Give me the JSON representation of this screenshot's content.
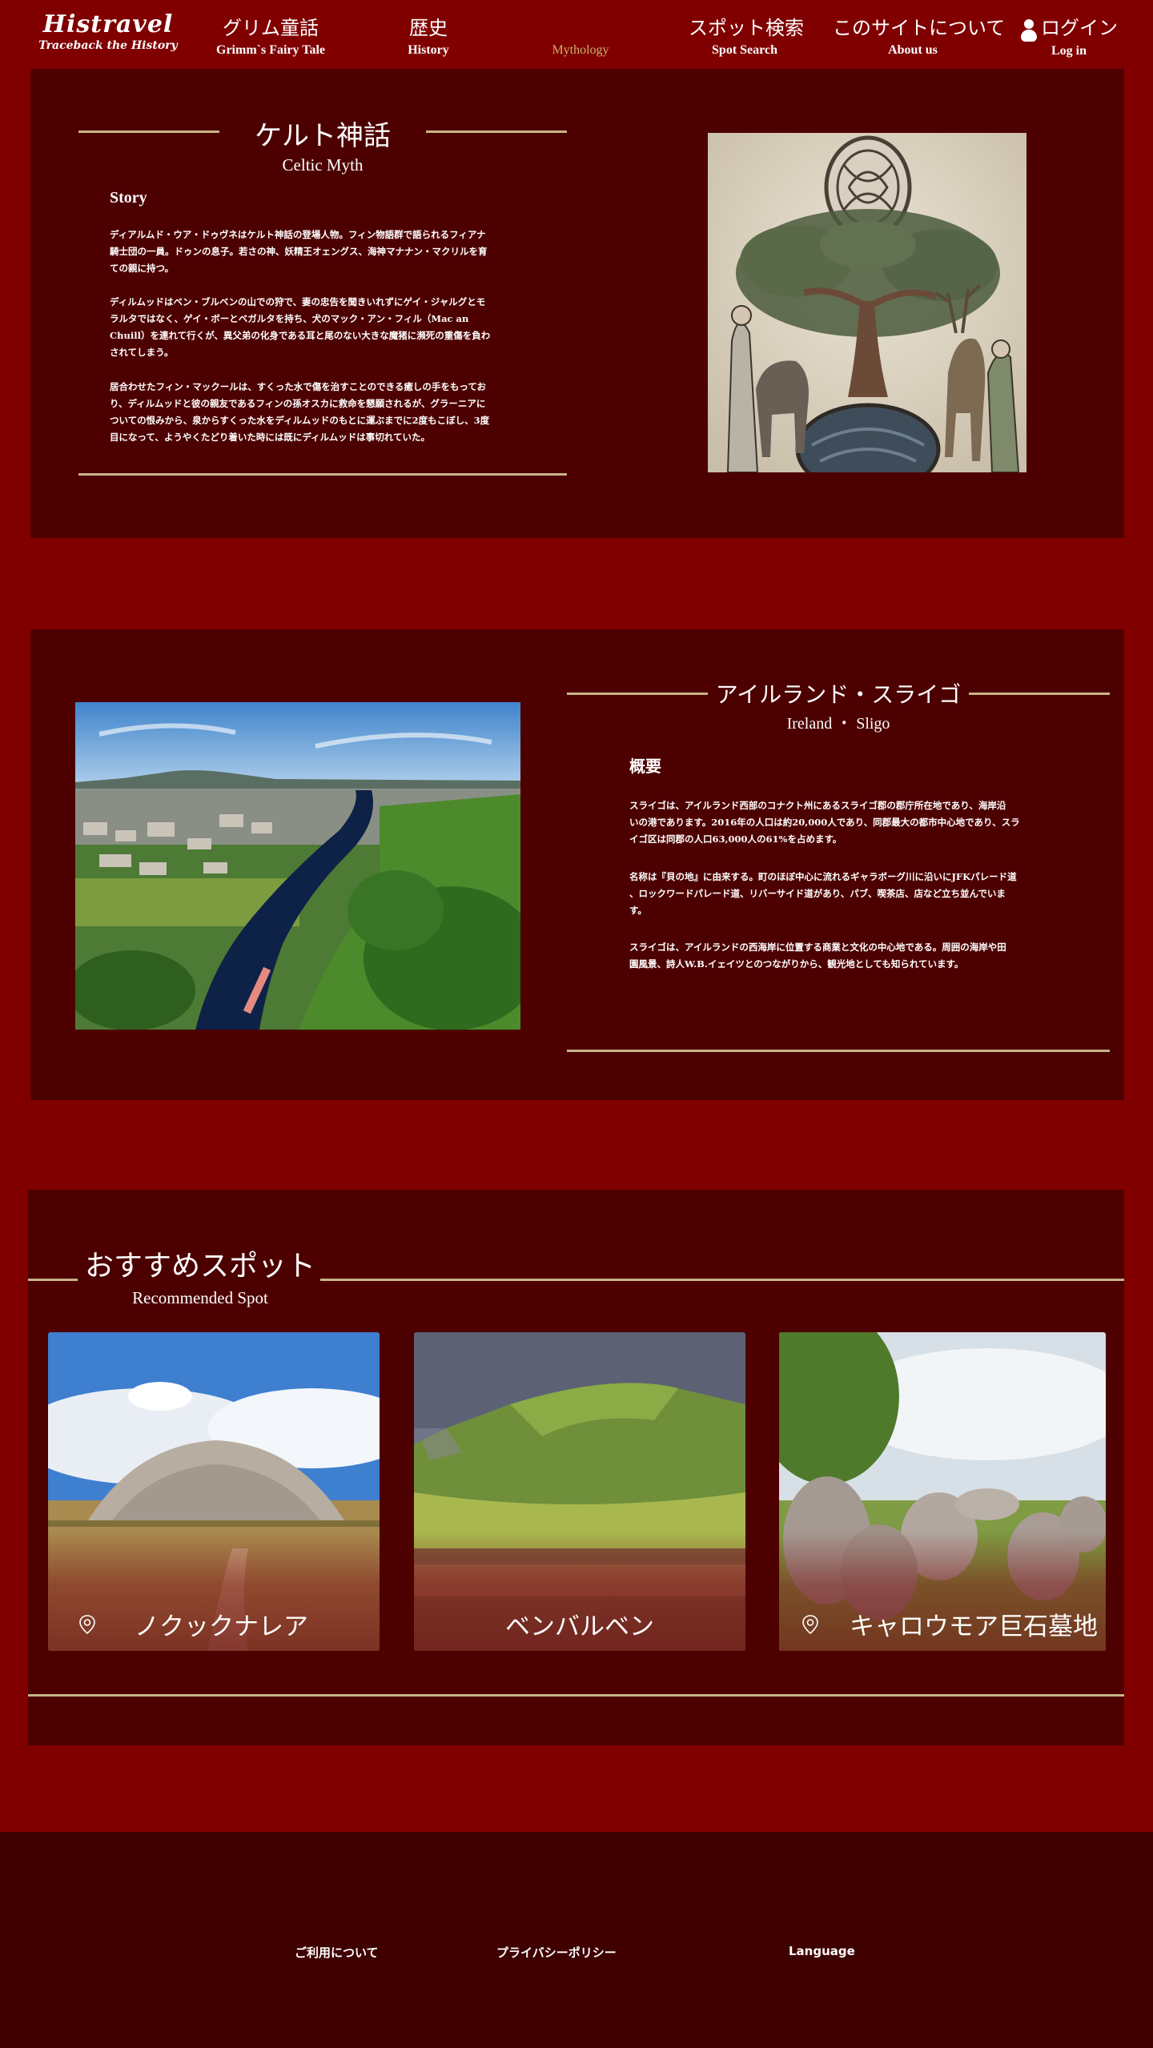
{
  "header": {
    "logo_title": "Histravel",
    "logo_subtitle": "Traceback the History",
    "nav": [
      {
        "jp": "グリム童話",
        "en": "Grimm`s Fairy Tale"
      },
      {
        "jp": "歴史",
        "en": "History"
      },
      {
        "jp": "",
        "en": "Mythology"
      },
      {
        "jp": "スポット検索",
        "en": "Spot Search"
      },
      {
        "jp": "このサイトについて",
        "en": "About us"
      },
      {
        "jp": "ログイン",
        "en": "Log in"
      }
    ],
    "active_nav": "Mythology"
  },
  "myth": {
    "title_jp": "ケルト神話",
    "title_en": "Celtic Myth",
    "section_label": "Story",
    "paragraphs": [
      [
        "ディアルムド・ウア・ドゥヴネはケルト神話の登場人物。フィン物語群で語られるフィアナ",
        "騎士団の一員。ドゥンの息子。若さの神、妖精王オェングス、海神マナナン・マクリルを育",
        "ての親に持つ。"
      ],
      [
        "ディルムッドはベン・ブルベンの山での狩で、妻の忠告を聞きいれずにゲイ・ジャルグとモ",
        "ラルタではなく、ゲイ・ボーとベガルタを持ち、犬のマック・アン・フィル（Mac an",
        "Chuill）を連れて行くが、異父弟の化身である耳と尾のない大きな魔猪に瀕死の重傷を負わ",
        "されてしまう。"
      ],
      [
        "居合わせたフィン・マックールは、すくった水で傷を治すことのできる癒しの手をもってお",
        "り、ディルムッドと彼の親友であるフィンの孫オスカに救命を懇願されるが、グラーニアに",
        "ついての恨みから、泉からすくった水をディルムッドのもとに運ぶまでに2度もこぼし、3度",
        "目になって、ようやくたどり着いた時には既にディルムッドは事切れていた。"
      ]
    ]
  },
  "place": {
    "title_jp": "アイルランド・スライゴ",
    "title_en": "Ireland ・ Sligo",
    "section_label": "概要",
    "paragraphs": [
      [
        "スライゴは、アイルランド西部のコナクト州にあるスライゴ郡の郡庁所在地であり、海岸沿",
        "いの港であります。2016年の人口は約20,000人であり、同郡最大の都市中心地であり、スラ",
        "イゴ区は同郡の人口63,000人の61%を占めます。"
      ],
      [
        "名称は『貝の地』に由来する。町のほぼ中心に流れるギャラボーグ川に沿いにJFKパレード道",
        "、ロックワードパレード道、リバーサイド道があり、パブ、喫茶店、店など立ち並んでいま",
        "す。"
      ],
      [
        "スライゴは、アイルランドの西海岸に位置する商業と文化の中心地である。周囲の海岸や田",
        "園風景、詩人W.B.イェイツとのつながりから、観光地としても知られています。"
      ]
    ]
  },
  "recommended": {
    "title_jp": "おすすめスポット",
    "title_en": "Recommended Spot",
    "spots": [
      {
        "name": "ノクックナレア",
        "icon": "map-pin-icon"
      },
      {
        "name": "ベンバルベン",
        "icon": ""
      },
      {
        "name": "キャロウモア巨石墓地",
        "icon": "map-pin-icon"
      }
    ]
  },
  "footer": {
    "terms": "ご利用について",
    "privacy": "プライバシーポリシー",
    "language": "Language"
  },
  "colors": {
    "background": "#800000",
    "panel": "#4d0000",
    "footer": "#3f0000",
    "gold_line": "#c7b487",
    "active_nav": "#c9b36b"
  }
}
